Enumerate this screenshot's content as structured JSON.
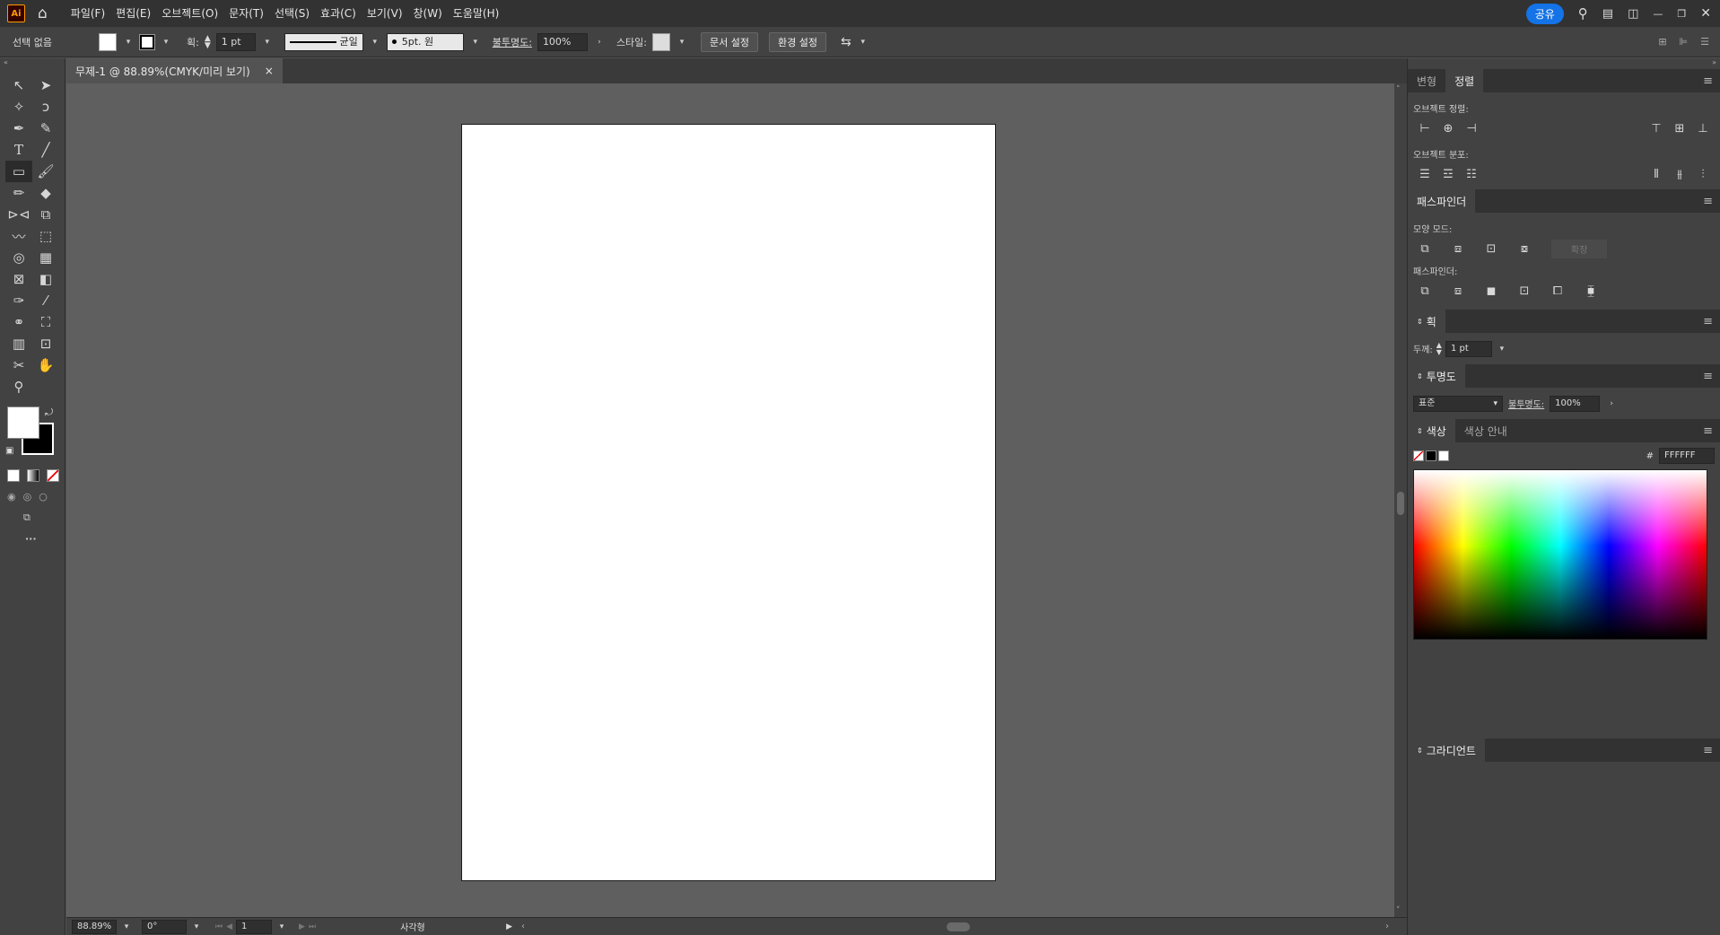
{
  "app": {
    "logo": "Ai"
  },
  "menu": {
    "items": [
      "파일(F)",
      "편집(E)",
      "오브젝트(O)",
      "문자(T)",
      "선택(S)",
      "효과(C)",
      "보기(V)",
      "창(W)",
      "도움말(H)"
    ],
    "share": "공유"
  },
  "controlbar": {
    "selection": "선택 없음",
    "stroke_label": "획:",
    "stroke_value": "1 pt",
    "line_style": "균일",
    "brush": "5pt. 원",
    "opacity_label": "불투명도:",
    "opacity_value": "100%",
    "style_label": "스타일:",
    "doc_setup": "문서 설정",
    "prefs": "환경 설정"
  },
  "document": {
    "tab_title": "무제-1 @ 88.89%(CMYK/미리 보기)",
    "close": "×"
  },
  "status": {
    "zoom": "88.89%",
    "rotation": "0°",
    "page": "1",
    "tool": "사각형"
  },
  "panels": {
    "align": {
      "tabs": [
        "변형",
        "정렬"
      ],
      "align_objects": "오브젝트 정렬:",
      "distribute_objects": "오브젝트 분포:"
    },
    "pathfinder": {
      "title": "패스파인더",
      "shape_modes": "모양 모드:",
      "expand": "확장",
      "pathfinders": "패스파인더:"
    },
    "stroke": {
      "title": "획",
      "weight_label": "두께:",
      "weight_value": "1 pt"
    },
    "transparency": {
      "title": "투명도",
      "mode": "표준",
      "opacity_label": "불투명도:",
      "opacity_value": "100%"
    },
    "color": {
      "tabs": [
        "색상",
        "색상 안내"
      ],
      "hex_label": "#",
      "hex_value": "FFFFFF"
    },
    "gradient": {
      "title": "그라디언트"
    }
  },
  "colors": {
    "menubar": "#323232",
    "panel": "#424242",
    "canvas": "#5f5f5f",
    "share": "#1473e6",
    "logo": "#ff9a00"
  }
}
